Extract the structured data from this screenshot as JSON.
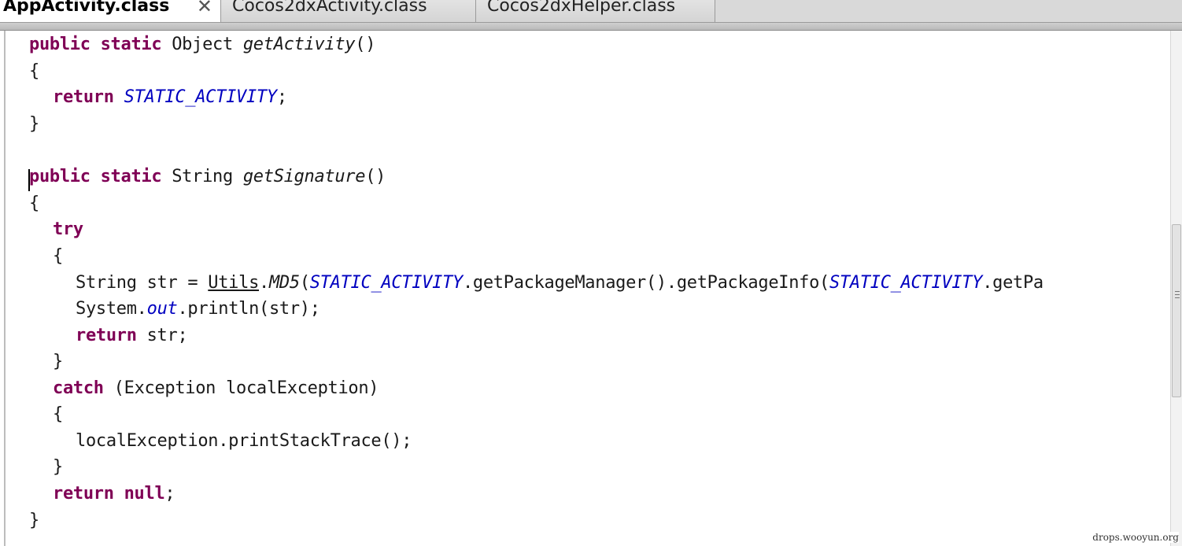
{
  "tabs": [
    {
      "label": "AppActivity.class",
      "active": true,
      "closable": true
    },
    {
      "label": "Cocos2dxActivity.class",
      "active": false
    },
    {
      "label": "Cocos2dxHelper.class",
      "active": false
    }
  ],
  "code": {
    "l1": {
      "kw": "public static",
      "type": " Object ",
      "name": "getActivity",
      "rest": "()"
    },
    "l2": "{",
    "l3": {
      "kw": "return",
      "field": "STATIC_ACTIVITY",
      "rest": ";"
    },
    "l4": "}",
    "l6": {
      "kw": "public static",
      "type": " String ",
      "name": "getSignature",
      "rest": "()"
    },
    "l7": "{",
    "l8": {
      "kw": "try"
    },
    "l9": "{",
    "l10": {
      "a": "String str = ",
      "cls": "Utils",
      "dot": ".",
      "method": "MD5",
      "open": "(",
      "field1": "STATIC_ACTIVITY",
      "mid": ".getPackageManager().getPackageInfo(",
      "field2": "STATIC_ACTIVITY",
      "tail": ".getPa"
    },
    "l11": {
      "a": "System.",
      "field": "out",
      "rest": ".println(str);"
    },
    "l12": {
      "kw": "return",
      "rest": " str;"
    },
    "l13": "}",
    "l14": {
      "kw": "catch",
      "rest": " (Exception localException)"
    },
    "l15": "{",
    "l16": "localException.printStackTrace();",
    "l17": "}",
    "l18": {
      "kw": "return null",
      "rest": ";"
    },
    "l19": "}"
  },
  "watermark": "drops.wooyun.org"
}
